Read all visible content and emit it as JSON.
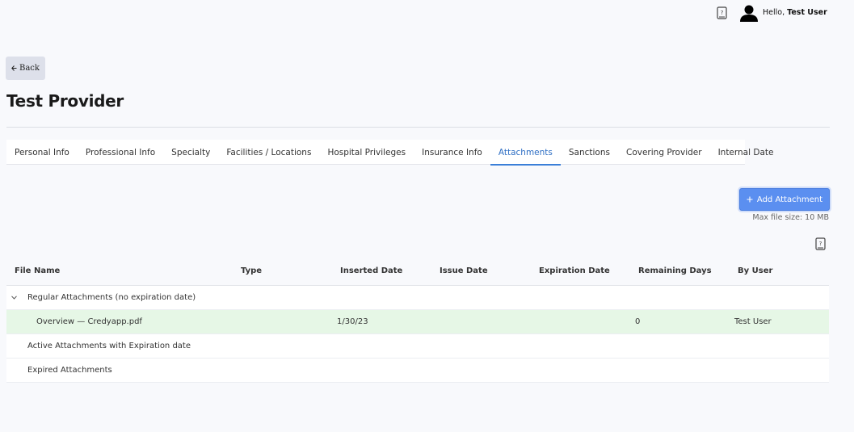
{
  "header": {
    "greeting_prefix": "Hello, ",
    "user_name": "Test User"
  },
  "back_label": "Back",
  "page_title": "Test Provider",
  "tabs": [
    {
      "label": "Personal Info"
    },
    {
      "label": "Professional Info"
    },
    {
      "label": "Specialty"
    },
    {
      "label": "Facilities / Locations"
    },
    {
      "label": "Hospital Privileges"
    },
    {
      "label": "Insurance Info"
    },
    {
      "label": "Attachments",
      "active": true
    },
    {
      "label": "Sanctions"
    },
    {
      "label": "Covering Provider"
    },
    {
      "label": "Internal Date"
    }
  ],
  "add_attachment_label": "Add Attachment",
  "max_file_size": "Max file size: 10 MB",
  "table": {
    "columns": [
      "File Name",
      "Type",
      "Inserted Date",
      "Issue Date",
      "Expiration Date",
      "Remaining Days",
      "By User"
    ],
    "groups": [
      {
        "label": "Regular Attachments (no expiration date)",
        "expanded": true,
        "files": [
          {
            "file_name": "Overview — Credyapp.pdf",
            "type": "",
            "inserted_date": "1/30/23",
            "issue_date": "",
            "expiration_date": "",
            "remaining_days": "0",
            "by_user": "Test User"
          }
        ]
      },
      {
        "label": "Active Attachments with Expiration date",
        "expanded": false,
        "files": []
      },
      {
        "label": "Expired Attachments",
        "expanded": false,
        "files": []
      }
    ]
  },
  "colors": {
    "accent": "#3a7fd8",
    "button": "#5b8ff0",
    "highlight_row": "#e6f7e6"
  }
}
